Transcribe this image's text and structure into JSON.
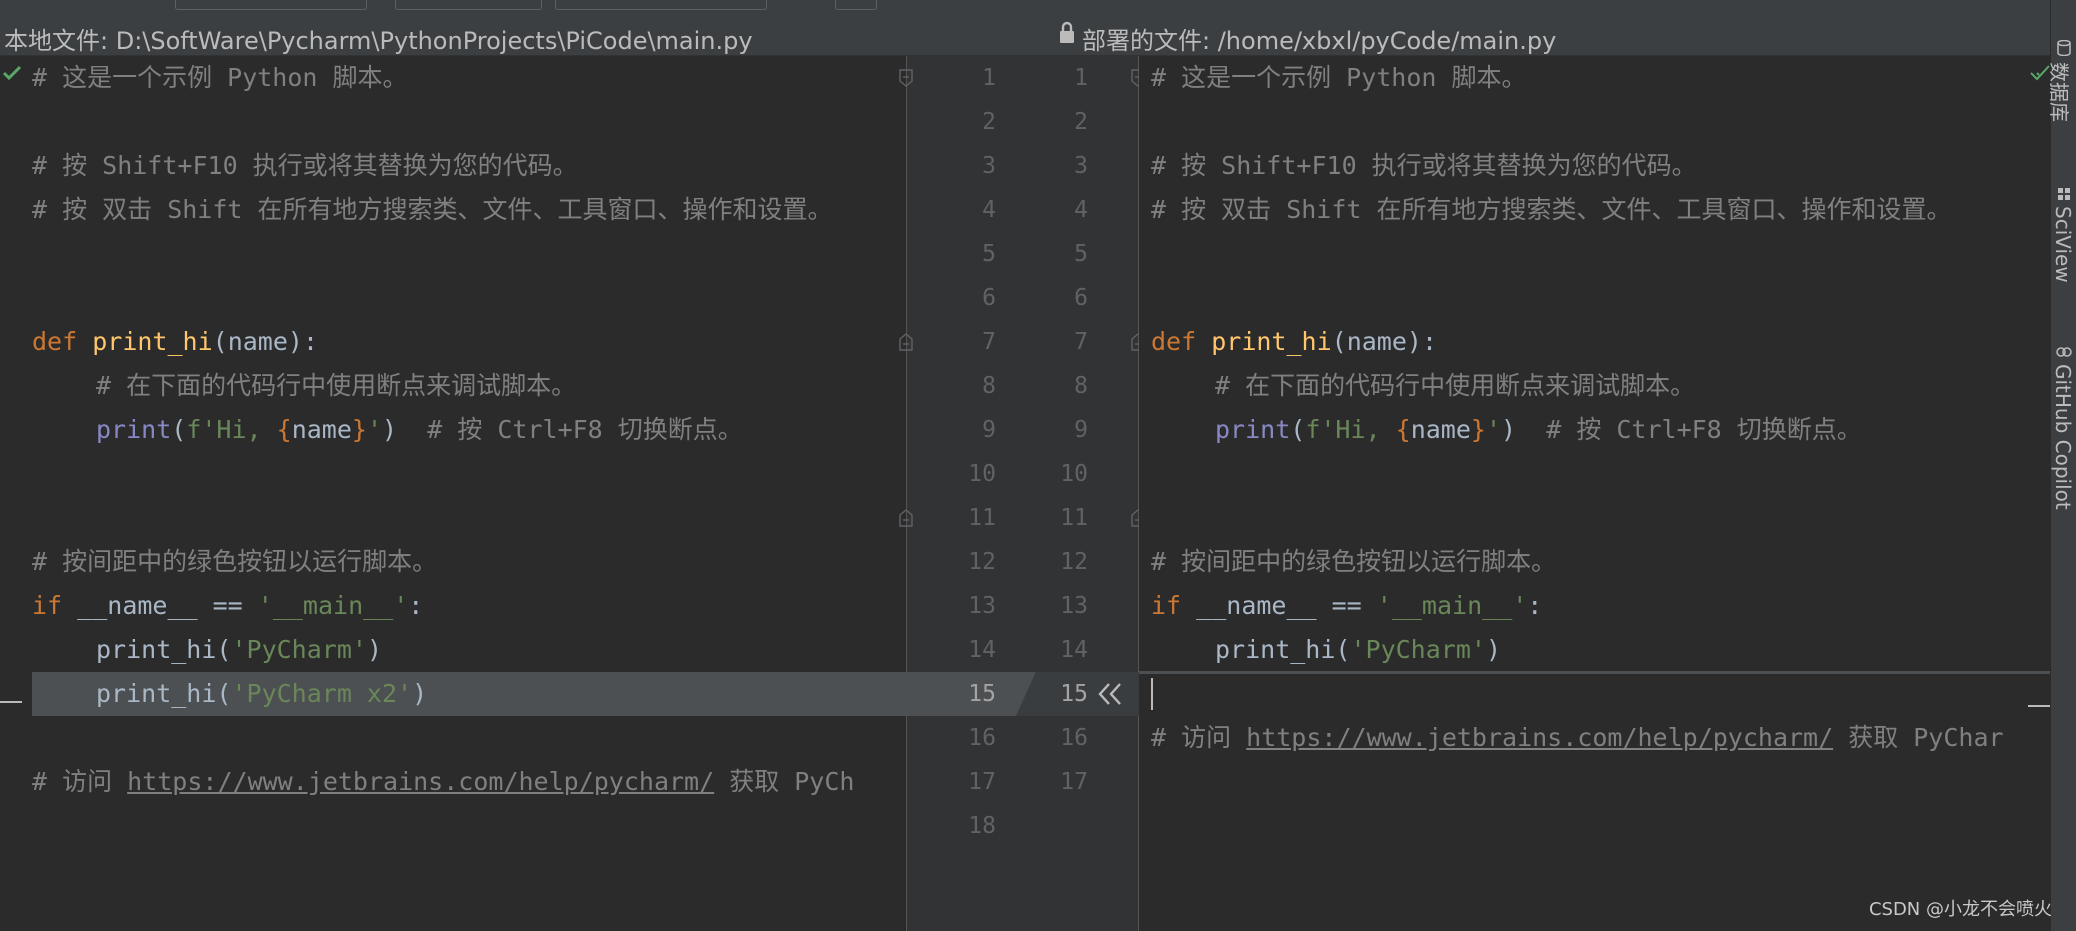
{
  "header": {
    "local_file": "本地文件: D:\\SoftWare\\Pycharm\\PythonProjects\\PiCode\\main.py",
    "deployed_file": "部署的文件: /home/xbxl/pyCode/main.py"
  },
  "left_code": {
    "l1": "# 这是一个示例 Python 脚本。",
    "l3": "# 按 Shift+F10 执行或将其替换为您的代码。",
    "l4": "# 按 双击 Shift 在所有地方搜索类、文件、工具窗口、操作和设置。",
    "l7_kw": "def",
    "l7_fn": "print_hi",
    "l7_rest": "(name):",
    "l8": "# 在下面的代码行中使用断点来调试脚本。",
    "l9_bi": "print",
    "l9_open": "(",
    "l9_str1": "f'Hi, ",
    "l9_brace1": "{",
    "l9_name": "name",
    "l9_brace2": "}",
    "l9_str2": "'",
    "l9_close": ")",
    "l9_com": "# 按 Ctrl+F8 切换断点。",
    "l12": "# 按间距中的绿色按钮以运行脚本。",
    "l13_kw": "if",
    "l13_mid": " __name__ == ",
    "l13_str": "'__main__'",
    "l13_end": ":",
    "l14_fn": "print_hi(",
    "l14_str": "'PyCharm'",
    "l14_end": ")",
    "l15_fn": "print_hi(",
    "l15_str": "'PyCharm x2'",
    "l15_end": ")",
    "l17_com": "# 访问 ",
    "l17_link": "https://www.jetbrains.com/help/pycharm/",
    "l17_tail": " 获取 PyCh"
  },
  "right_code": {
    "l1": "# 这是一个示例 Python 脚本。",
    "l3": "# 按 Shift+F10 执行或将其替换为您的代码。",
    "l4": "# 按 双击 Shift 在所有地方搜索类、文件、工具窗口、操作和设置。",
    "l7_kw": "def",
    "l7_fn": "print_hi",
    "l7_rest": "(name):",
    "l8": "# 在下面的代码行中使用断点来调试脚本。",
    "l9_bi": "print",
    "l9_open": "(",
    "l9_str1": "f'Hi, ",
    "l9_brace1": "{",
    "l9_name": "name",
    "l9_brace2": "}",
    "l9_str2": "'",
    "l9_close": ")",
    "l9_com": "# 按 Ctrl+F8 切换断点。",
    "l12": "# 按间距中的绿色按钮以运行脚本。",
    "l13_kw": "if",
    "l13_mid": " __name__ == ",
    "l13_str": "'__main__'",
    "l13_end": ":",
    "l14_fn": "print_hi(",
    "l14_str": "'PyCharm'",
    "l14_end": ")",
    "l16_com": "# 访问 ",
    "l16_link": "https://www.jetbrains.com/help/pycharm/",
    "l16_tail": " 获取 PyChar"
  },
  "gutter": {
    "left_numbers": [
      "1",
      "2",
      "3",
      "4",
      "5",
      "6",
      "7",
      "8",
      "9",
      "10",
      "11",
      "12",
      "13",
      "14",
      "15",
      "16",
      "17",
      "18"
    ],
    "right_numbers": [
      "1",
      "2",
      "3",
      "4",
      "5",
      "6",
      "7",
      "8",
      "9",
      "10",
      "11",
      "12",
      "13",
      "14",
      "15",
      "16",
      "17"
    ]
  },
  "sidebar": {
    "tab_database": "数据库",
    "tab_sciview": "SciView",
    "tab_copilot": "GitHub Copilot"
  },
  "watermark": "CSDN @小龙不会喷火",
  "colors": {
    "background": "#2b2b2b",
    "gutter": "#313335",
    "highlight": "#4c5052",
    "comment": "#808080",
    "keyword": "#cc7832",
    "function": "#ffc66d",
    "string": "#6a8759",
    "builtin": "#8888c6",
    "check_ok": "#59a869"
  },
  "icons": [
    "check-icon",
    "lock-icon",
    "fold-marker-icon",
    "apply-left-icon",
    "database-icon",
    "sciview-icon",
    "copilot-icon"
  ]
}
